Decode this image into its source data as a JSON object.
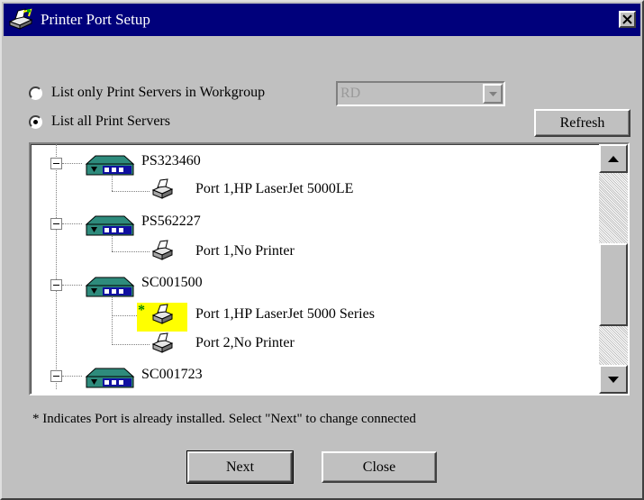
{
  "window": {
    "title": "Printer Port Setup",
    "close_label": "×"
  },
  "options": {
    "workgroup_only_label": "List only Print Servers in Workgroup",
    "workgroup_only_selected": false,
    "list_all_label": "List all Print Servers",
    "list_all_selected": true,
    "workgroup_value": "RD"
  },
  "buttons": {
    "refresh": "Refresh",
    "next": "Next",
    "close": "Close"
  },
  "tree": {
    "servers": [
      {
        "name": "PS323460",
        "ports": [
          "Port 1,HP LaserJet 5000LE"
        ]
      },
      {
        "name": "PS562227",
        "ports": [
          "Port 1,No Printer"
        ]
      },
      {
        "name": "SC001500",
        "ports": [
          "Port 1,HP LaserJet 5000 Series",
          "Port 2,No Printer"
        ]
      },
      {
        "name": "SC001723",
        "ports": []
      }
    ],
    "installed_marker": "*"
  },
  "note": "* Indicates Port is already installed. Select \"Next\" to change connected",
  "icons": {
    "app": "printer-setup-icon",
    "server": "print-server-icon",
    "port": "printer-icon"
  },
  "colors": {
    "title_bar": "#00007b",
    "face": "#c0c0c0",
    "highlight": "#ffff00",
    "installed_mark": "#008000"
  }
}
